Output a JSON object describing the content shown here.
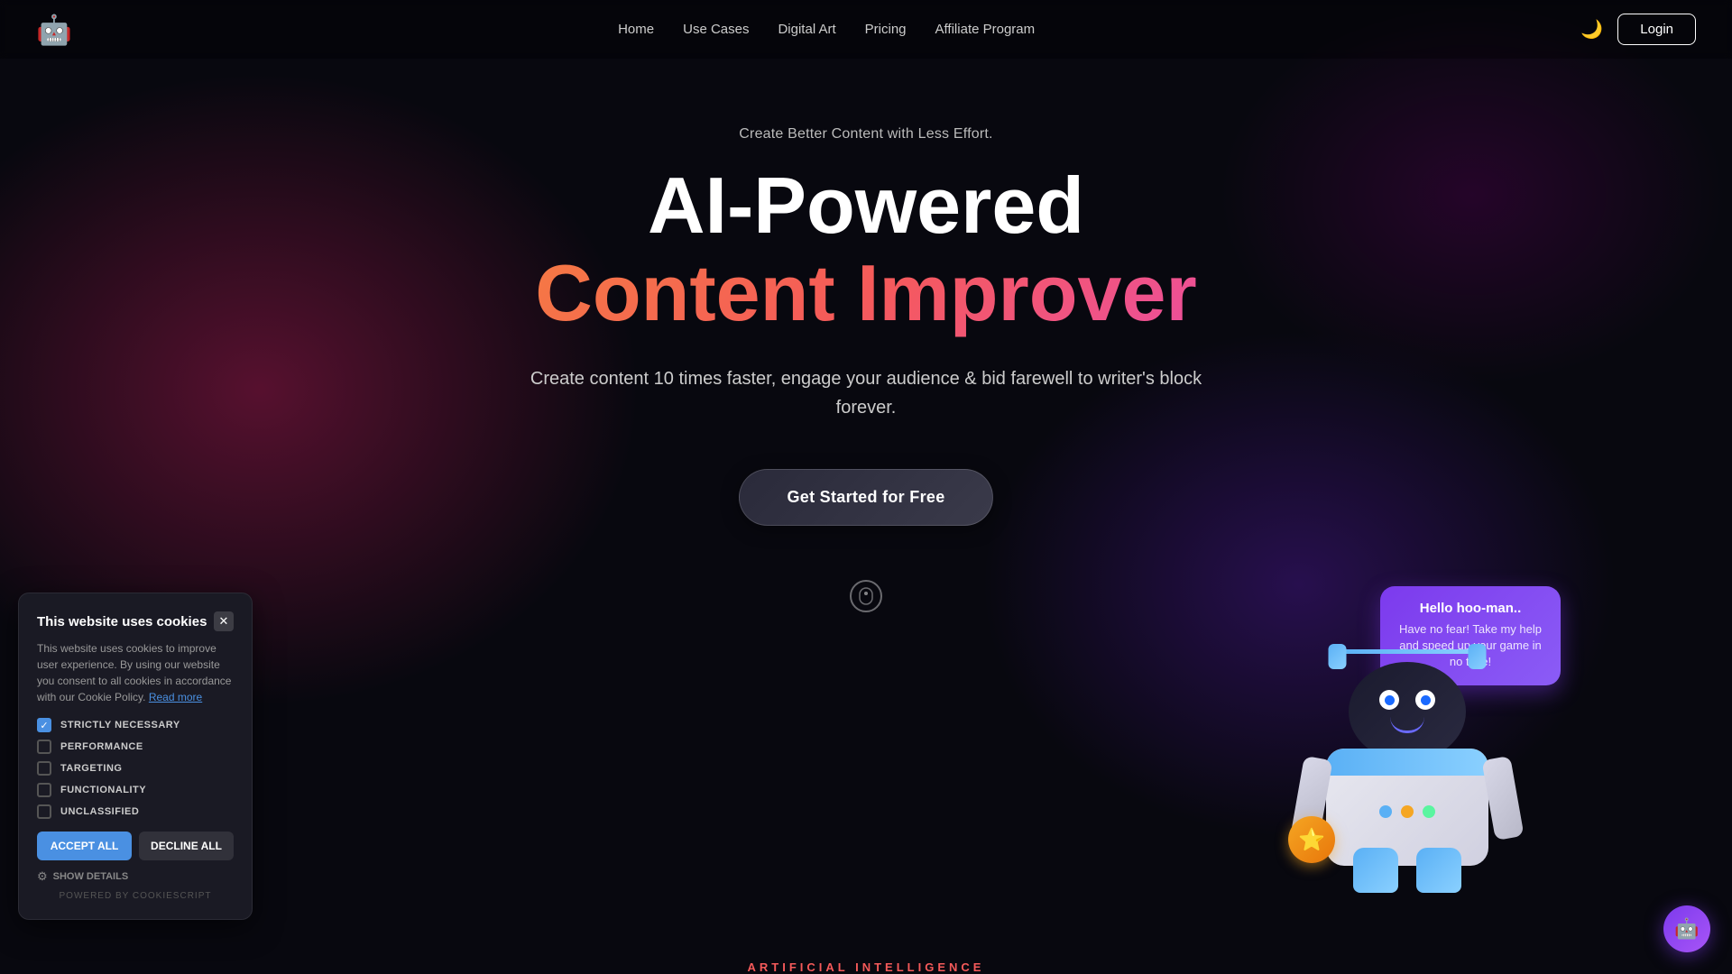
{
  "navbar": {
    "logo_emoji": "🤖",
    "nav_items": [
      {
        "label": "Home",
        "id": "home"
      },
      {
        "label": "Use Cases",
        "id": "use-cases"
      },
      {
        "label": "Digital Art",
        "id": "digital-art"
      },
      {
        "label": "Pricing",
        "id": "pricing"
      },
      {
        "label": "Affiliate Program",
        "id": "affiliate"
      }
    ],
    "theme_icon": "🌙",
    "login_label": "Login"
  },
  "hero": {
    "subtitle": "Create Better Content with Less Effort.",
    "title_line1": "AI-Powered",
    "title_line2": "Content Improver",
    "description": "Create content 10 times faster, engage your audience & bid farewell to writer's block forever.",
    "cta_button": "Get Started for Free",
    "scroll_icon": "⬇"
  },
  "robot": {
    "chat_title": "Hello hoo-man..",
    "chat_text": "Have no fear! Take my help and speed up your game in no time!",
    "badge_icon": "⭐"
  },
  "bottom_label": "ARTIFICIAL INTELLIGENCE",
  "cookie": {
    "title": "This website uses cookies",
    "description": "This website uses cookies to improve user experience. By using our website you consent to all cookies in accordance with our Cookie Policy.",
    "read_more": "Read more",
    "close_icon": "✕",
    "options": [
      {
        "label": "STRICTLY NECESSARY",
        "checked": true
      },
      {
        "label": "PERFORMANCE",
        "checked": false
      },
      {
        "label": "TARGETING",
        "checked": false
      },
      {
        "label": "FUNCTIONALITY",
        "checked": false
      },
      {
        "label": "UNCLASSIFIED",
        "checked": false
      }
    ],
    "accept_btn": "ACCEPT ALL",
    "decline_btn": "DECLINE ALL",
    "show_details": "SHOW DETAILS",
    "powered": "POWERED BY COOKIESCRIPT"
  },
  "chat_widget": {
    "icon": "🤖"
  }
}
